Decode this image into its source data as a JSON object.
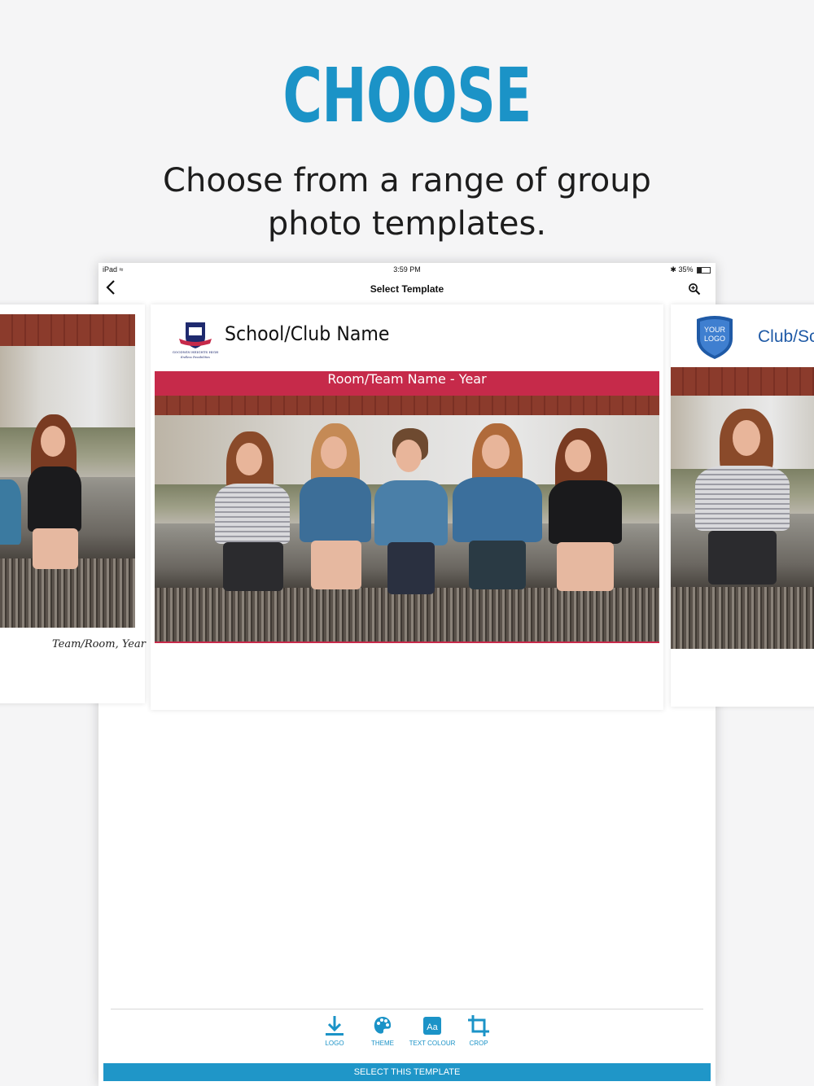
{
  "promo": {
    "headline": "CHOOSE",
    "subhead_line1": "Choose from a range of group",
    "subhead_line2": "photo templates."
  },
  "status_bar": {
    "device": "iPad",
    "time": "3:59 PM",
    "battery": "35%"
  },
  "nav": {
    "title": "Select Template",
    "back_icon": "chevron-left-icon",
    "zoom_icon": "zoom-in-icon"
  },
  "templates": {
    "left": {
      "caption": "Team/Room, Year"
    },
    "center": {
      "title": "School/Club Name",
      "ribbon": "Room/Team Name - Year",
      "crest_text": "GOODWIN HEIGHTS HIGH",
      "crest_motto": "Endless Possibilities"
    },
    "right": {
      "logo_line1": "YOUR",
      "logo_line2": "LOGO",
      "title": "Club/Sc"
    }
  },
  "toolbar": {
    "items": [
      {
        "label": "LOGO",
        "icon": "download-icon"
      },
      {
        "label": "THEME",
        "icon": "palette-icon"
      },
      {
        "label": "TEXT COLOUR",
        "icon": "text-aa-icon",
        "glyph": "Aa"
      },
      {
        "label": "CROP",
        "icon": "crop-icon"
      }
    ],
    "select_label": "SELECT THIS TEMPLATE"
  },
  "colors": {
    "accent": "#1b93c7",
    "ribbon": "#c62a4a",
    "logo_blue": "#1f5aa6"
  }
}
